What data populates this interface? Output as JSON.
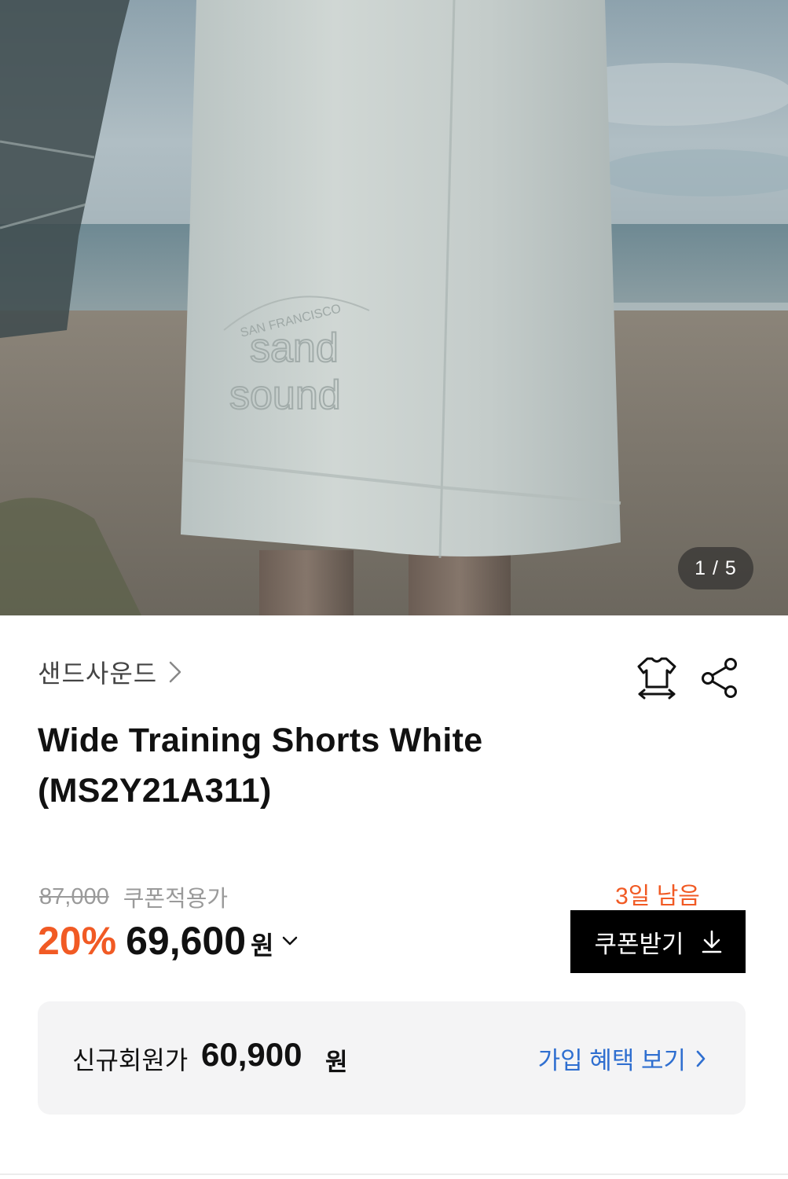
{
  "gallery": {
    "counter": "1 / 5",
    "embroidery_top": "SAN FRANCISCO",
    "embroidery_line1": "sand",
    "embroidery_line2": "sound"
  },
  "brand": {
    "name": "샌드사운드",
    "chevron_icon": "chevron-right-icon"
  },
  "actions": {
    "size_icon": "tshirt-size-icon",
    "share_icon": "share-icon"
  },
  "product": {
    "title_line1": "Wide Training Shorts White",
    "title_line2": "(MS2Y21A311)"
  },
  "pricing": {
    "original_price": "87,000",
    "coupon_label": "쿠폰적용가",
    "discount": "20%",
    "sale_price": "69,600",
    "currency": "원",
    "discount_color": "#f15a24"
  },
  "coupon": {
    "days_left": "3일 남음",
    "button_label": "쿠폰받기",
    "button_icon": "download-icon"
  },
  "member": {
    "label": "신규회원가",
    "price": "60,900",
    "currency": "원",
    "link_label": "가입 혜택 보기",
    "link_color": "#2f6fd0"
  }
}
